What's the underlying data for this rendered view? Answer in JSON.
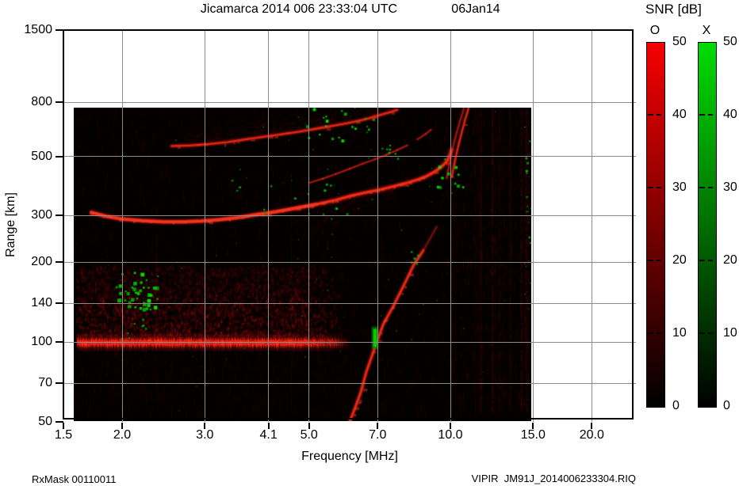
{
  "title": {
    "main": "Jicamarca 2014 006 23:33:04 UTC",
    "date": "06Jan14"
  },
  "footer": {
    "left": "RxMask 00110011",
    "right": "VIPIR  JM91J_2014006233304.RIQ"
  },
  "axes": {
    "x": {
      "label": "Frequency [MHz]",
      "scale": "log",
      "ticks": [
        1.5,
        2.0,
        3.0,
        4.1,
        5.0,
        7.0,
        10.0,
        15.0,
        20.0
      ],
      "tick_labels": [
        "1.5",
        "2.0",
        "3.0",
        "4.1",
        "5.0",
        "7.0",
        "10.0",
        "15.0",
        "20.0"
      ],
      "min": 1.5,
      "max": 24.8
    },
    "y": {
      "label": "Range [km]",
      "scale": "log",
      "ticks": [
        50,
        70,
        100,
        140,
        200,
        300,
        500,
        800,
        1500
      ],
      "tick_labels": [
        "50",
        "70",
        "100",
        "140",
        "200",
        "300",
        "500",
        "800",
        "1500"
      ],
      "min": 50,
      "max": 1500
    }
  },
  "colorbar": {
    "title": "SNR [dB]",
    "min": 0,
    "max": 50,
    "ticks": [
      50,
      40,
      30,
      20,
      10,
      0
    ],
    "tick_labels": [
      "50",
      "40",
      "30",
      "20",
      "10",
      "0"
    ],
    "dashed_ticks": [
      40,
      30,
      20,
      10
    ],
    "bars": [
      {
        "label": "O",
        "top_color": "#f50000",
        "bottom_color": "#000000"
      },
      {
        "label": "X",
        "top_color": "#00dc00",
        "bottom_color": "#000000"
      }
    ]
  },
  "chart_data": {
    "type": "heatmap",
    "title": "Jicamarca 2014 006 23:33:04 UTC 06Jan14",
    "xlabel": "Frequency [MHz]",
    "ylabel": "Range [km]",
    "legend": "SNR [dB] 0-50, O-mode red, X-mode green",
    "x_range_mhz": [
      1.5,
      24.8
    ],
    "y_range_km": [
      50,
      1500
    ],
    "data_extent": {
      "freq_mhz": [
        1.57,
        15.0
      ],
      "range_km": [
        50,
        765
      ]
    },
    "colors": {
      "background": "#040000",
      "o_mode": "#ff2d19",
      "x_mode": "#00c800",
      "grid": "#8c8c8c"
    },
    "features": {
      "e_layer_band": {
        "freq_mhz": [
          1.6,
          5.62
        ],
        "fade_to_mhz": 6.1,
        "range_km": 100,
        "half_width_km": 8
      },
      "e_region_cloud": {
        "freq_mhz": [
          1.6,
          6.0
        ],
        "range_km": [
          103,
          195
        ]
      },
      "sub_e_noise": {
        "freq_mhz": [
          1.6,
          6.3
        ],
        "range_km": [
          52,
          92
        ]
      },
      "f_trace_o": {
        "points": [
          [
            1.72,
            308
          ],
          [
            1.85,
            298
          ],
          [
            2.0,
            291
          ],
          [
            2.2,
            287
          ],
          [
            2.45,
            284
          ],
          [
            2.7,
            284
          ],
          [
            2.95,
            286
          ],
          [
            3.2,
            289
          ],
          [
            3.5,
            294
          ],
          [
            3.85,
            302
          ],
          [
            4.25,
            310
          ],
          [
            4.7,
            320
          ],
          [
            5.2,
            331
          ],
          [
            5.7,
            343
          ],
          [
            6.15,
            356
          ],
          [
            6.6,
            366
          ],
          [
            7.1,
            376
          ],
          [
            7.6,
            387
          ],
          [
            8.0,
            396
          ],
          [
            8.5,
            409
          ],
          [
            8.9,
            422
          ],
          [
            9.25,
            438
          ],
          [
            9.55,
            456
          ],
          [
            9.8,
            477
          ],
          [
            9.95,
            500
          ],
          [
            10.05,
            530
          ]
        ]
      },
      "f_trace_x": {
        "points": [
          [
            5.0,
            398
          ],
          [
            5.35,
            413
          ],
          [
            5.7,
            430
          ],
          [
            6.1,
            450
          ],
          [
            6.5,
            470
          ],
          [
            6.9,
            488
          ],
          [
            7.3,
            508
          ],
          [
            7.7,
            529
          ],
          [
            8.1,
            552
          ],
          [
            8.5,
            580
          ],
          [
            8.85,
            608
          ],
          [
            9.1,
            632
          ],
          [
            9.2,
            645
          ]
        ]
      },
      "second_hop": {
        "points": [
          [
            2.55,
            548
          ],
          [
            2.8,
            551
          ],
          [
            3.05,
            557
          ],
          [
            3.35,
            567
          ],
          [
            3.65,
            580
          ],
          [
            4.0,
            594
          ],
          [
            4.4,
            608
          ],
          [
            4.8,
            622
          ],
          [
            5.25,
            640
          ],
          [
            5.7,
            656
          ],
          [
            6.15,
            673
          ],
          [
            6.6,
            692
          ],
          [
            7.05,
            716
          ],
          [
            7.45,
            736
          ],
          [
            7.7,
            750
          ]
        ],
        "diffuse_above": true
      },
      "spread_below_f": {
        "freq_mhz": [
          4.6,
          7.6
        ],
        "depth_frac": 0.25
      },
      "fof2_asymptote_o": {
        "points": [
          [
            10.07,
            420
          ],
          [
            10.17,
            460
          ],
          [
            10.28,
            505
          ],
          [
            10.4,
            550
          ],
          [
            10.52,
            595
          ],
          [
            10.63,
            640
          ],
          [
            10.75,
            690
          ],
          [
            10.87,
            735
          ],
          [
            10.95,
            772
          ]
        ]
      },
      "fof2_asymptote_x": {
        "points": [
          [
            9.82,
            415
          ],
          [
            9.92,
            455
          ],
          [
            10.02,
            500
          ],
          [
            10.14,
            548
          ],
          [
            10.26,
            594
          ],
          [
            10.38,
            640
          ],
          [
            10.5,
            688
          ],
          [
            10.62,
            733
          ],
          [
            10.7,
            770
          ]
        ]
      },
      "oblique_trace": {
        "points": [
          [
            6.1,
            50
          ],
          [
            6.28,
            57
          ],
          [
            6.45,
            65
          ],
          [
            6.62,
            77
          ],
          [
            6.9,
            95
          ],
          [
            7.2,
            117
          ],
          [
            7.55,
            136
          ],
          [
            7.95,
            163
          ],
          [
            8.35,
            195
          ],
          [
            8.75,
            221
          ]
        ]
      },
      "oblique_trace_tail": {
        "points": [
          [
            8.75,
            221
          ],
          [
            9.1,
            250
          ],
          [
            9.35,
            272
          ]
        ]
      },
      "green_bar": {
        "freq_mhz": [
          6.85,
          6.97
        ],
        "range_km": [
          96,
          112
        ]
      },
      "speckle_clusters": [
        {
          "f": [
            1.93,
            2.42
          ],
          "R": [
            132,
            186
          ],
          "n": 42,
          "s": [
            2,
            5
          ],
          "b": 1
        },
        {
          "f": [
            1.98,
            2.28
          ],
          "R": [
            100,
            126
          ],
          "n": 8,
          "s": [
            2,
            3
          ],
          "b": 0.8
        },
        {
          "f": [
            4.9,
            6.3
          ],
          "R": [
            580,
            780
          ],
          "n": 16,
          "s": [
            2,
            4
          ],
          "b": 1
        },
        {
          "f": [
            9.3,
            10.6
          ],
          "R": [
            380,
            530
          ],
          "n": 12,
          "s": [
            2,
            4
          ],
          "b": 0.9
        },
        {
          "f": [
            7.0,
            7.8
          ],
          "R": [
            480,
            565
          ],
          "n": 7,
          "s": [
            2,
            3
          ],
          "b": 0.8
        },
        {
          "f": [
            14.35,
            14.95
          ],
          "R": [
            140,
            720
          ],
          "n": 24,
          "s": [
            1,
            3
          ],
          "b": 0.8
        },
        {
          "f": [
            3.2,
            6.1
          ],
          "R": [
            290,
            430
          ],
          "n": 16,
          "s": [
            2,
            3
          ],
          "b": 0.9
        },
        {
          "f": [
            8.2,
            8.7
          ],
          "R": [
            190,
            235
          ],
          "n": 5,
          "s": [
            2,
            3
          ],
          "b": 0.9
        },
        {
          "f": [
            6.3,
            6.9
          ],
          "R": [
            620,
            700
          ],
          "n": 6,
          "s": [
            2,
            3
          ],
          "b": 0.8
        },
        {
          "f": [
            2.5,
            14.8
          ],
          "R": [
            55,
            770
          ],
          "n": 70,
          "s": [
            1,
            2
          ],
          "b": 0.45
        }
      ],
      "rfi_stripes": [
        {
          "f": 2.36,
          "a": 0.16,
          "R": [
            60,
            330
          ]
        },
        {
          "f": 4.57,
          "a": 0.1,
          "R": [
            55,
            430
          ],
          "g": 1
        },
        {
          "f": 9.6,
          "a": 0.06,
          "R": [
            60,
            500
          ],
          "g": 1
        },
        {
          "f": 10.1,
          "a": 0.1,
          "R": [
            60,
            760
          ]
        },
        {
          "f": 10.22,
          "a": 0.07,
          "R": [
            60,
            760
          ]
        },
        {
          "f": 12.3,
          "a": 0.12,
          "R": [
            55,
            760
          ]
        },
        {
          "f": 13.4,
          "a": 0.18,
          "R": [
            55,
            760
          ]
        },
        {
          "f": 14.15,
          "a": 0.2,
          "R": [
            55,
            760
          ]
        },
        {
          "f": 14.55,
          "a": 0.16,
          "R": [
            55,
            760
          ]
        }
      ],
      "random_rfi_band_mhz": [
        11.2,
        14.9
      ]
    }
  }
}
